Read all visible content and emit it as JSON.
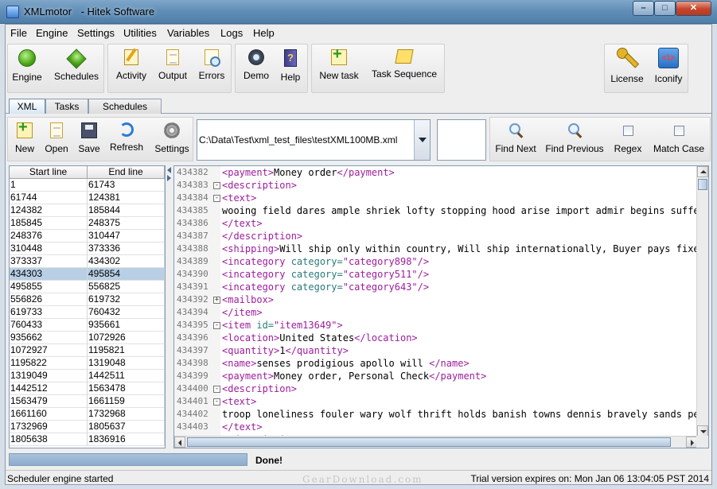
{
  "window": {
    "title": "XMLmotor",
    "subtitle": "- Hitek Software",
    "controls": {
      "minimize": "–",
      "maximize": "□",
      "close": "✕"
    }
  },
  "menu": [
    "File",
    "Engine",
    "Settings",
    "Utilities",
    "Variables",
    "Logs",
    "Help"
  ],
  "toolbar": {
    "engine": "Engine",
    "schedules": "Schedules",
    "activity": "Activity",
    "output": "Output",
    "errors": "Errors",
    "demo": "Demo",
    "help": "Help",
    "new_task": "New task",
    "task_sequence": "Task Sequence",
    "license": "License",
    "iconify": "Iconify",
    "iconify_glyph": "<\\>"
  },
  "tabs": [
    "XML",
    "Tasks",
    "Schedules"
  ],
  "xml_toolbar": {
    "new": "New",
    "open": "Open",
    "save": "Save",
    "refresh": "Refresh",
    "settings": "Settings",
    "file_path": "C:\\Data\\Test\\xml_test_files\\testXML100MB.xml",
    "search_value": "",
    "find_next": "Find Next",
    "find_previous": "Find Previous",
    "regex": "Regex",
    "match_case": "Match Case"
  },
  "line_table": {
    "headers": [
      "Start line",
      "End line"
    ],
    "selected_index": 7,
    "rows": [
      [
        "1",
        "61743"
      ],
      [
        "61744",
        "124381"
      ],
      [
        "124382",
        "185844"
      ],
      [
        "185845",
        "248375"
      ],
      [
        "248376",
        "310447"
      ],
      [
        "310448",
        "373336"
      ],
      [
        "373337",
        "434302"
      ],
      [
        "434303",
        "495854"
      ],
      [
        "495855",
        "556825"
      ],
      [
        "556826",
        "619732"
      ],
      [
        "619733",
        "760432"
      ],
      [
        "760433",
        "935661"
      ],
      [
        "935662",
        "1072926"
      ],
      [
        "1072927",
        "1195821"
      ],
      [
        "1195822",
        "1319048"
      ],
      [
        "1319049",
        "1442511"
      ],
      [
        "1442512",
        "1563478"
      ],
      [
        "1563479",
        "1661159"
      ],
      [
        "1661160",
        "1732968"
      ],
      [
        "1732969",
        "1805637"
      ],
      [
        "1805638",
        "1836916"
      ]
    ]
  },
  "editor_lines": [
    {
      "n": "434382",
      "fold": "",
      "parts": [
        [
          "tg",
          "<payment>"
        ],
        [
          "ct",
          "Money order"
        ],
        [
          "tg",
          "</payment>"
        ]
      ]
    },
    {
      "n": "434383",
      "fold": "-",
      "parts": [
        [
          "tg",
          "<description>"
        ]
      ]
    },
    {
      "n": "434384",
      "fold": "-",
      "parts": [
        [
          "tg",
          "<text>"
        ]
      ]
    },
    {
      "n": "434385",
      "fold": "",
      "parts": [
        [
          "ct",
          "wooing field dares ample shriek lofty stopping hood arise import admir begins sufferance"
        ]
      ]
    },
    {
      "n": "434386",
      "fold": "",
      "parts": [
        [
          "tg",
          "</text>"
        ]
      ]
    },
    {
      "n": "434387",
      "fold": "",
      "parts": [
        [
          "tg",
          "</description>"
        ]
      ]
    },
    {
      "n": "434388",
      "fold": "",
      "parts": [
        [
          "tg",
          "<shipping>"
        ],
        [
          "ct",
          "Will ship only within country, Will ship internationally, Buyer pays fixed shipping"
        ]
      ]
    },
    {
      "n": "434389",
      "fold": "",
      "parts": [
        [
          "tg",
          "<incategory "
        ],
        [
          "at",
          "category="
        ],
        [
          "av",
          "\"category898\""
        ],
        [
          "tg",
          "/>"
        ]
      ]
    },
    {
      "n": "434390",
      "fold": "",
      "parts": [
        [
          "tg",
          "<incategory "
        ],
        [
          "at",
          "category="
        ],
        [
          "av",
          "\"category511\""
        ],
        [
          "tg",
          "/>"
        ]
      ]
    },
    {
      "n": "434391",
      "fold": "",
      "parts": [
        [
          "tg",
          "<incategory "
        ],
        [
          "at",
          "category="
        ],
        [
          "av",
          "\"category643\""
        ],
        [
          "tg",
          "/>"
        ]
      ]
    },
    {
      "n": "434392",
      "fold": "+",
      "parts": [
        [
          "tg",
          "<mailbox>"
        ]
      ]
    },
    {
      "n": "434394",
      "fold": "",
      "parts": [
        [
          "tg",
          "</item>"
        ]
      ]
    },
    {
      "n": "434395",
      "fold": "-",
      "parts": [
        [
          "tg",
          "<item "
        ],
        [
          "at",
          "id="
        ],
        [
          "av",
          "\"item13649\""
        ],
        [
          "tg",
          ">"
        ]
      ]
    },
    {
      "n": "434396",
      "fold": "",
      "parts": [
        [
          "tg",
          "<location>"
        ],
        [
          "ct",
          "United States"
        ],
        [
          "tg",
          "</location>"
        ]
      ]
    },
    {
      "n": "434397",
      "fold": "",
      "parts": [
        [
          "tg",
          "<quantity>"
        ],
        [
          "ct",
          "1"
        ],
        [
          "tg",
          "</quantity>"
        ]
      ]
    },
    {
      "n": "434398",
      "fold": "",
      "parts": [
        [
          "tg",
          "<name>"
        ],
        [
          "ct",
          "senses prodigious apollo will "
        ],
        [
          "tg",
          "</name>"
        ]
      ]
    },
    {
      "n": "434399",
      "fold": "",
      "parts": [
        [
          "tg",
          "<payment>"
        ],
        [
          "ct",
          "Money order, Personal Check"
        ],
        [
          "tg",
          "</payment>"
        ]
      ]
    },
    {
      "n": "434400",
      "fold": "-",
      "parts": [
        [
          "tg",
          "<description>"
        ]
      ]
    },
    {
      "n": "434401",
      "fold": "-",
      "parts": [
        [
          "tg",
          "<text>"
        ]
      ]
    },
    {
      "n": "434402",
      "fold": "",
      "parts": [
        [
          "ct",
          "troop loneliness fouler wary wolf thrift holds banish towns dennis bravely sands perform"
        ]
      ]
    },
    {
      "n": "434403",
      "fold": "",
      "parts": [
        [
          "tg",
          "</text>"
        ]
      ]
    },
    {
      "n": "434404",
      "fold": "",
      "parts": [
        [
          "tg",
          "</description>"
        ]
      ]
    }
  ],
  "progress": {
    "fraction": 1.0,
    "status_text": "Done!"
  },
  "status": {
    "left": "Scheduler engine started",
    "right": "Trial version expires on: Mon Jan 06 13:04:05 PST 2014"
  },
  "watermark": "GearDownload.com",
  "colors": {
    "tag": "#9c1d9c",
    "attr": "#2a7a7a",
    "selection": "#b8cfe5"
  }
}
